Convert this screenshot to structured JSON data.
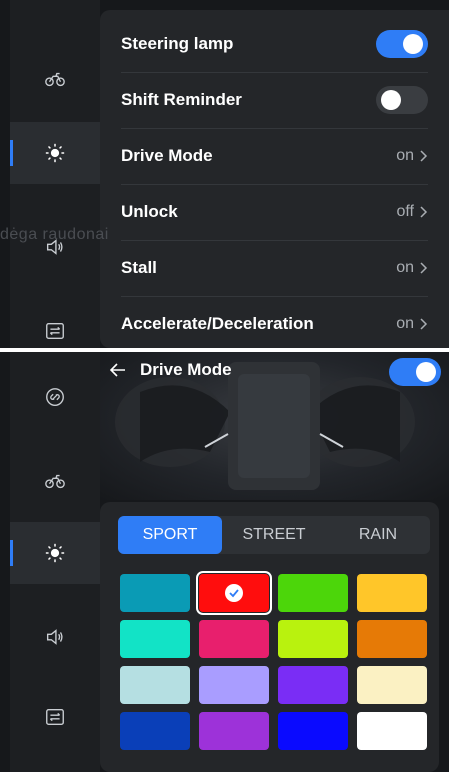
{
  "top": {
    "sidebar": [
      {
        "icon": "motorcycle-icon",
        "active": false
      },
      {
        "icon": "brightness-icon",
        "active": true
      },
      {
        "icon": "speaker-icon",
        "active": false
      },
      {
        "icon": "tune-icon",
        "active": false
      }
    ],
    "rows": [
      {
        "label": "Steering lamp",
        "type": "toggle",
        "on": true
      },
      {
        "label": "Shift Reminder",
        "type": "toggle",
        "on": false
      },
      {
        "label": "Drive Mode",
        "type": "value",
        "value": "on"
      },
      {
        "label": "Unlock",
        "type": "value",
        "value": "off"
      },
      {
        "label": "Stall",
        "type": "value",
        "value": "on"
      },
      {
        "label": "Accelerate/Deceleration",
        "type": "value",
        "value": "on"
      }
    ],
    "overlay_text": "dėga raudonai"
  },
  "bottom": {
    "sidebar": [
      {
        "icon": "link-icon",
        "active": false
      },
      {
        "icon": "motorcycle-icon",
        "active": false
      },
      {
        "icon": "brightness-icon",
        "active": true
      },
      {
        "icon": "speaker-icon",
        "active": false
      },
      {
        "icon": "tune-icon",
        "active": false
      }
    ],
    "title": "Drive Mode",
    "toggle_on": true,
    "modes": [
      "SPORT",
      "STREET",
      "RAIN"
    ],
    "active_mode": "SPORT",
    "swatches": [
      "#0a9bb5",
      "#ff0d0d",
      "#4cd60a",
      "#ffc629",
      "#12e3c6",
      "#e81f6d",
      "#b9f20e",
      "#e67a06",
      "#b5dfe2",
      "#a99dff",
      "#7a2df5",
      "#fbf1c3",
      "#0a3fb8",
      "#9d32d9",
      "#0a0aff",
      "#ffffff"
    ],
    "selected_swatch": 1
  }
}
